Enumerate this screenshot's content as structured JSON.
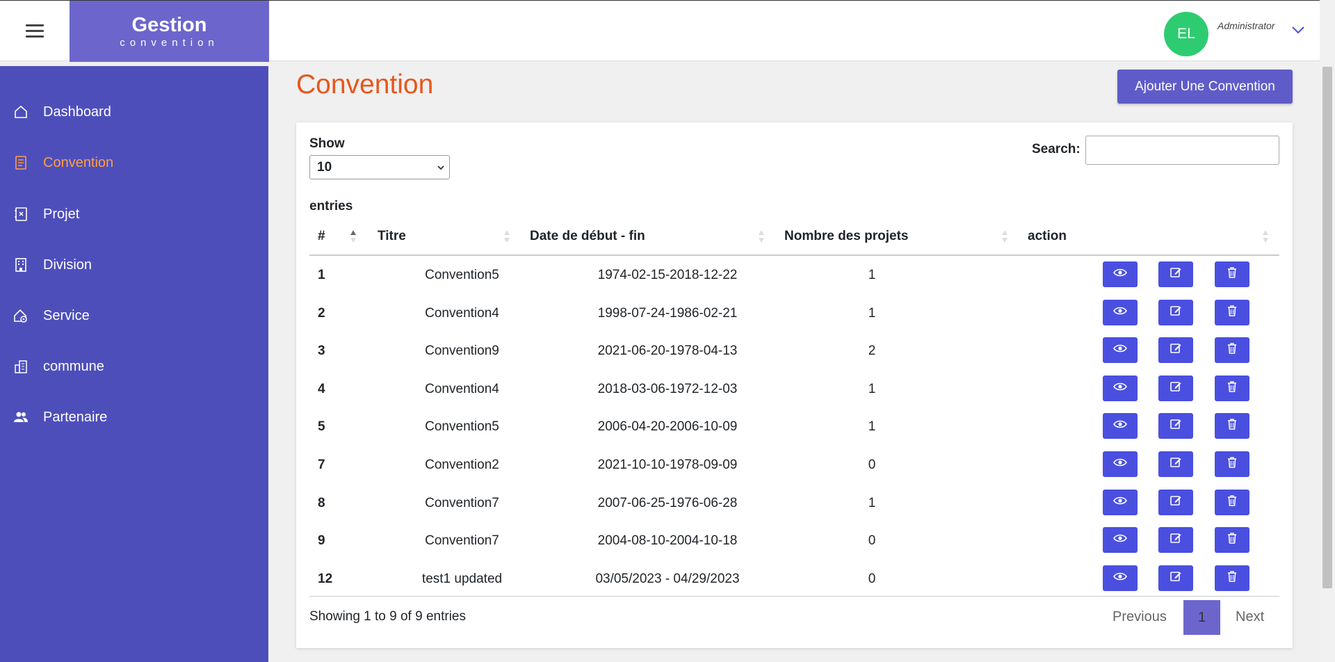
{
  "brand": {
    "name": "Gestion",
    "subtitle": "convention"
  },
  "user": {
    "initials": "EL",
    "role": "Administrator"
  },
  "sidebar": {
    "items": [
      {
        "label": "Dashboard",
        "icon": "home-icon"
      },
      {
        "label": "Convention",
        "icon": "document-icon",
        "active": true
      },
      {
        "label": "Projet",
        "icon": "project-icon"
      },
      {
        "label": "Division",
        "icon": "building-icon"
      },
      {
        "label": "Service",
        "icon": "service-icon"
      },
      {
        "label": "commune",
        "icon": "city-icon"
      },
      {
        "label": "Partenaire",
        "icon": "users-icon"
      }
    ]
  },
  "page": {
    "title": "Convention",
    "add_button": "Ajouter Une Convention"
  },
  "table_controls": {
    "show_label": "Show",
    "show_value": "10",
    "entries_label": "entries",
    "search_label": "Search:",
    "search_value": ""
  },
  "table": {
    "columns": [
      "#",
      "Titre",
      "Date de début - fin",
      "Nombre des projets",
      "action"
    ],
    "rows": [
      {
        "id": "1",
        "titre": "Convention5",
        "dates": "1974-02-15-2018-12-22",
        "projets": "1"
      },
      {
        "id": "2",
        "titre": "Convention4",
        "dates": "1998-07-24-1986-02-21",
        "projets": "1"
      },
      {
        "id": "3",
        "titre": "Convention9",
        "dates": "2021-06-20-1978-04-13",
        "projets": "2"
      },
      {
        "id": "4",
        "titre": "Convention4",
        "dates": "2018-03-06-1972-12-03",
        "projets": "1"
      },
      {
        "id": "5",
        "titre": "Convention5",
        "dates": "2006-04-20-2006-10-09",
        "projets": "1"
      },
      {
        "id": "7",
        "titre": "Convention2",
        "dates": "2021-10-10-1978-09-09",
        "projets": "0"
      },
      {
        "id": "8",
        "titre": "Convention7",
        "dates": "2007-06-25-1976-06-28",
        "projets": "1"
      },
      {
        "id": "9",
        "titre": "Convention7",
        "dates": "2004-08-10-2004-10-18",
        "projets": "0"
      },
      {
        "id": "12",
        "titre": "test1 updated",
        "dates": "03/05/2023 - 04/29/2023",
        "projets": "0"
      }
    ]
  },
  "footer": {
    "info": "Showing 1 to 9 of 9 entries",
    "previous": "Previous",
    "current_page": "1",
    "next": "Next"
  },
  "colors": {
    "sidebar": "#4e4ebb",
    "brand": "#6c66cc",
    "title": "#e8561c",
    "active_nav": "#ff9f43",
    "action_button": "#4a4fe0",
    "avatar": "#2ecc71"
  }
}
